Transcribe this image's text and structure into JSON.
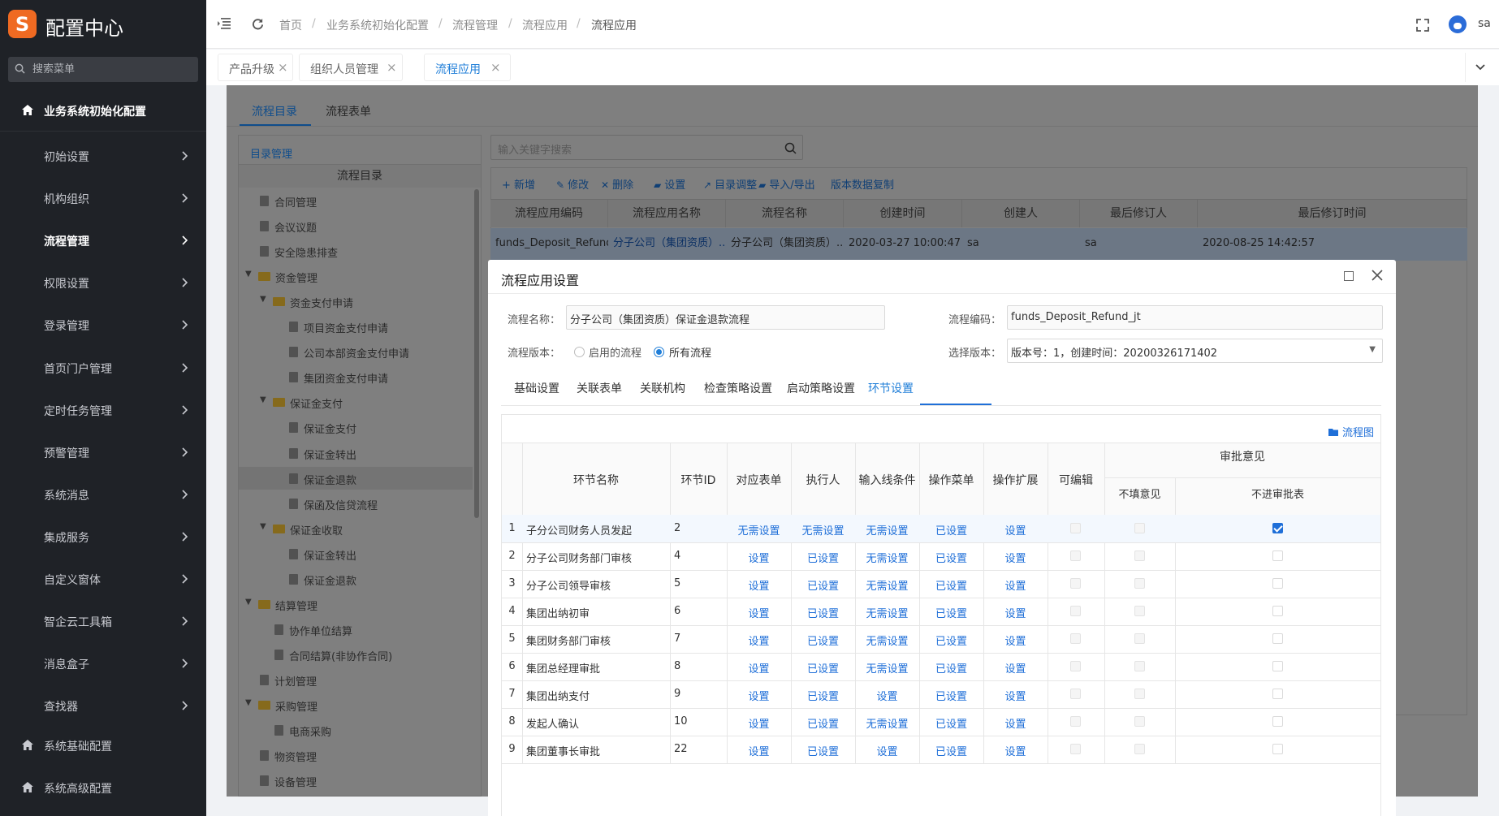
{
  "sidebar": {
    "logo_letter": "S",
    "title": "配置中心",
    "search_placeholder": "搜索菜单",
    "top_section": "业务系统初始化配置",
    "items": [
      {
        "label": "初始设置"
      },
      {
        "label": "机构组织"
      },
      {
        "label": "流程管理"
      },
      {
        "label": "权限设置"
      },
      {
        "label": "登录管理"
      },
      {
        "label": "首页门户管理"
      },
      {
        "label": "定时任务管理"
      },
      {
        "label": "预警管理"
      },
      {
        "label": "系统消息"
      },
      {
        "label": "集成服务"
      },
      {
        "label": "自定义窗体"
      },
      {
        "label": "智企云工具箱"
      },
      {
        "label": "消息盒子"
      },
      {
        "label": "查找器"
      }
    ],
    "bottom_sections": [
      "系统基础配置",
      "系统高级配置"
    ]
  },
  "header": {
    "breadcrumb": [
      "首页",
      "业务系统初始化配置",
      "流程管理",
      "流程应用",
      "流程应用"
    ],
    "user": "sa"
  },
  "page_tabs": [
    {
      "label": "产品升级"
    },
    {
      "label": "组织人员管理"
    },
    {
      "label": "流程应用"
    }
  ],
  "content": {
    "sub_tabs": [
      "流程目录",
      "流程表单"
    ],
    "catalog_header": "目录管理",
    "tree_title": "流程目录",
    "search_placeholder": "输入关键字搜索",
    "toolbar": [
      "+ 新增",
      "修改",
      "删除",
      "设置",
      "目录调整",
      "导入/导出",
      "版本数据复制"
    ],
    "tree": [
      {
        "label": "合同管理",
        "type": "file",
        "level": 1
      },
      {
        "label": "会议议题",
        "type": "file",
        "level": 1
      },
      {
        "label": "安全隐患排查",
        "type": "file",
        "level": 1
      },
      {
        "label": "资金管理",
        "type": "folder",
        "level": 0
      },
      {
        "label": "资金支付申请",
        "type": "folder",
        "level": 1
      },
      {
        "label": "项目资金支付申请",
        "type": "file",
        "level": 3
      },
      {
        "label": "公司本部资金支付申请",
        "type": "file",
        "level": 3
      },
      {
        "label": "集团资金支付申请",
        "type": "file",
        "level": 3
      },
      {
        "label": "保证金支付",
        "type": "folder",
        "level": 1
      },
      {
        "label": "保证金支付",
        "type": "file",
        "level": 3
      },
      {
        "label": "保证金转出",
        "type": "file",
        "level": 3
      },
      {
        "label": "保证金退款",
        "type": "file",
        "level": 3
      },
      {
        "label": "保函及信贷流程",
        "type": "file",
        "level": 3
      },
      {
        "label": "保证金收取",
        "type": "folder",
        "level": 1
      },
      {
        "label": "保证金转出",
        "type": "file",
        "level": 3
      },
      {
        "label": "保证金退款",
        "type": "file",
        "level": 3
      },
      {
        "label": "结算管理",
        "type": "folder",
        "level": 0
      },
      {
        "label": "协作单位结算",
        "type": "file",
        "level": 2
      },
      {
        "label": "合同结算(非协作合同)",
        "type": "file",
        "level": 2
      },
      {
        "label": "计划管理",
        "type": "file",
        "level": 1
      },
      {
        "label": "采购管理",
        "type": "folder",
        "level": 0
      },
      {
        "label": "电商采购",
        "type": "file",
        "level": 2
      },
      {
        "label": "物资管理",
        "type": "file",
        "level": 1
      },
      {
        "label": "设备管理",
        "type": "file",
        "level": 1
      }
    ],
    "table_columns": [
      "流程应用编码",
      "流程应用名称",
      "流程名称",
      "创建时间",
      "创建人",
      "最后修订人",
      "最后修订时间"
    ],
    "table_row": [
      "funds_Deposit_Refund_jt",
      "分子公司（集团资质）...",
      "分子公司（集团资质）...",
      "2020-03-27 10:00:47",
      "sa",
      "sa",
      "2020-08-25 14:42:57"
    ]
  },
  "modal": {
    "title": "流程应用设置",
    "flow_name_label": "流程名称：",
    "flow_name": "分子公司（集团资质）保证金退款流程",
    "flow_code_label": "流程编码：",
    "flow_code": "funds_Deposit_Refund_jt",
    "version_label": "流程版本：",
    "radio_enabled": "启用的流程",
    "radio_all": "所有流程",
    "select_version_label": "选择版本：",
    "select_version": "版本号：1，创建时间：20200326171402",
    "tabs": [
      "基础设置",
      "关联表单",
      "关联机构",
      "检查策略设置",
      "启动策略设置",
      "环节设置"
    ],
    "flowchart_link": "流程图",
    "grid": {
      "headers": [
        "环节名称",
        "环节ID",
        "对应表单",
        "执行人",
        "输入线条件",
        "操作菜单",
        "操作扩展",
        "可编辑",
        "审批意见"
      ],
      "sub_headers": [
        "不填意见",
        "不进审批表"
      ],
      "rows": [
        {
          "no": "1",
          "name": "子分公司财务人员发起",
          "id": "2",
          "form": "无需设置",
          "exec": "无需设置",
          "cond": "无需设置",
          "menu": "已设置",
          "ext": "设置",
          "editable": false,
          "no_opinion": false,
          "no_table": true
        },
        {
          "no": "2",
          "name": "分子公司财务部门审核",
          "id": "4",
          "form": "设置",
          "exec": "已设置",
          "cond": "无需设置",
          "menu": "已设置",
          "ext": "设置",
          "editable": false,
          "no_opinion": false,
          "no_table": false
        },
        {
          "no": "3",
          "name": "分子公司领导审核",
          "id": "5",
          "form": "设置",
          "exec": "已设置",
          "cond": "无需设置",
          "menu": "已设置",
          "ext": "设置",
          "editable": false,
          "no_opinion": false,
          "no_table": false
        },
        {
          "no": "4",
          "name": "集团出纳初审",
          "id": "6",
          "form": "设置",
          "exec": "已设置",
          "cond": "无需设置",
          "menu": "已设置",
          "ext": "设置",
          "editable": false,
          "no_opinion": false,
          "no_table": false
        },
        {
          "no": "5",
          "name": "集团财务部门审核",
          "id": "7",
          "form": "设置",
          "exec": "已设置",
          "cond": "无需设置",
          "menu": "已设置",
          "ext": "设置",
          "editable": false,
          "no_opinion": false,
          "no_table": false
        },
        {
          "no": "6",
          "name": "集团总经理审批",
          "id": "8",
          "form": "设置",
          "exec": "已设置",
          "cond": "无需设置",
          "menu": "已设置",
          "ext": "设置",
          "editable": false,
          "no_opinion": false,
          "no_table": false
        },
        {
          "no": "7",
          "name": "集团出纳支付",
          "id": "9",
          "form": "设置",
          "exec": "已设置",
          "cond": "设置",
          "menu": "已设置",
          "ext": "设置",
          "editable": false,
          "no_opinion": false,
          "no_table": false
        },
        {
          "no": "8",
          "name": "发起人确认",
          "id": "10",
          "form": "设置",
          "exec": "已设置",
          "cond": "无需设置",
          "menu": "已设置",
          "ext": "设置",
          "editable": false,
          "no_opinion": false,
          "no_table": false
        },
        {
          "no": "9",
          "name": "集团董事长审批",
          "id": "22",
          "form": "设置",
          "exec": "已设置",
          "cond": "设置",
          "menu": "已设置",
          "ext": "设置",
          "editable": false,
          "no_opinion": false,
          "no_table": false
        }
      ]
    }
  }
}
